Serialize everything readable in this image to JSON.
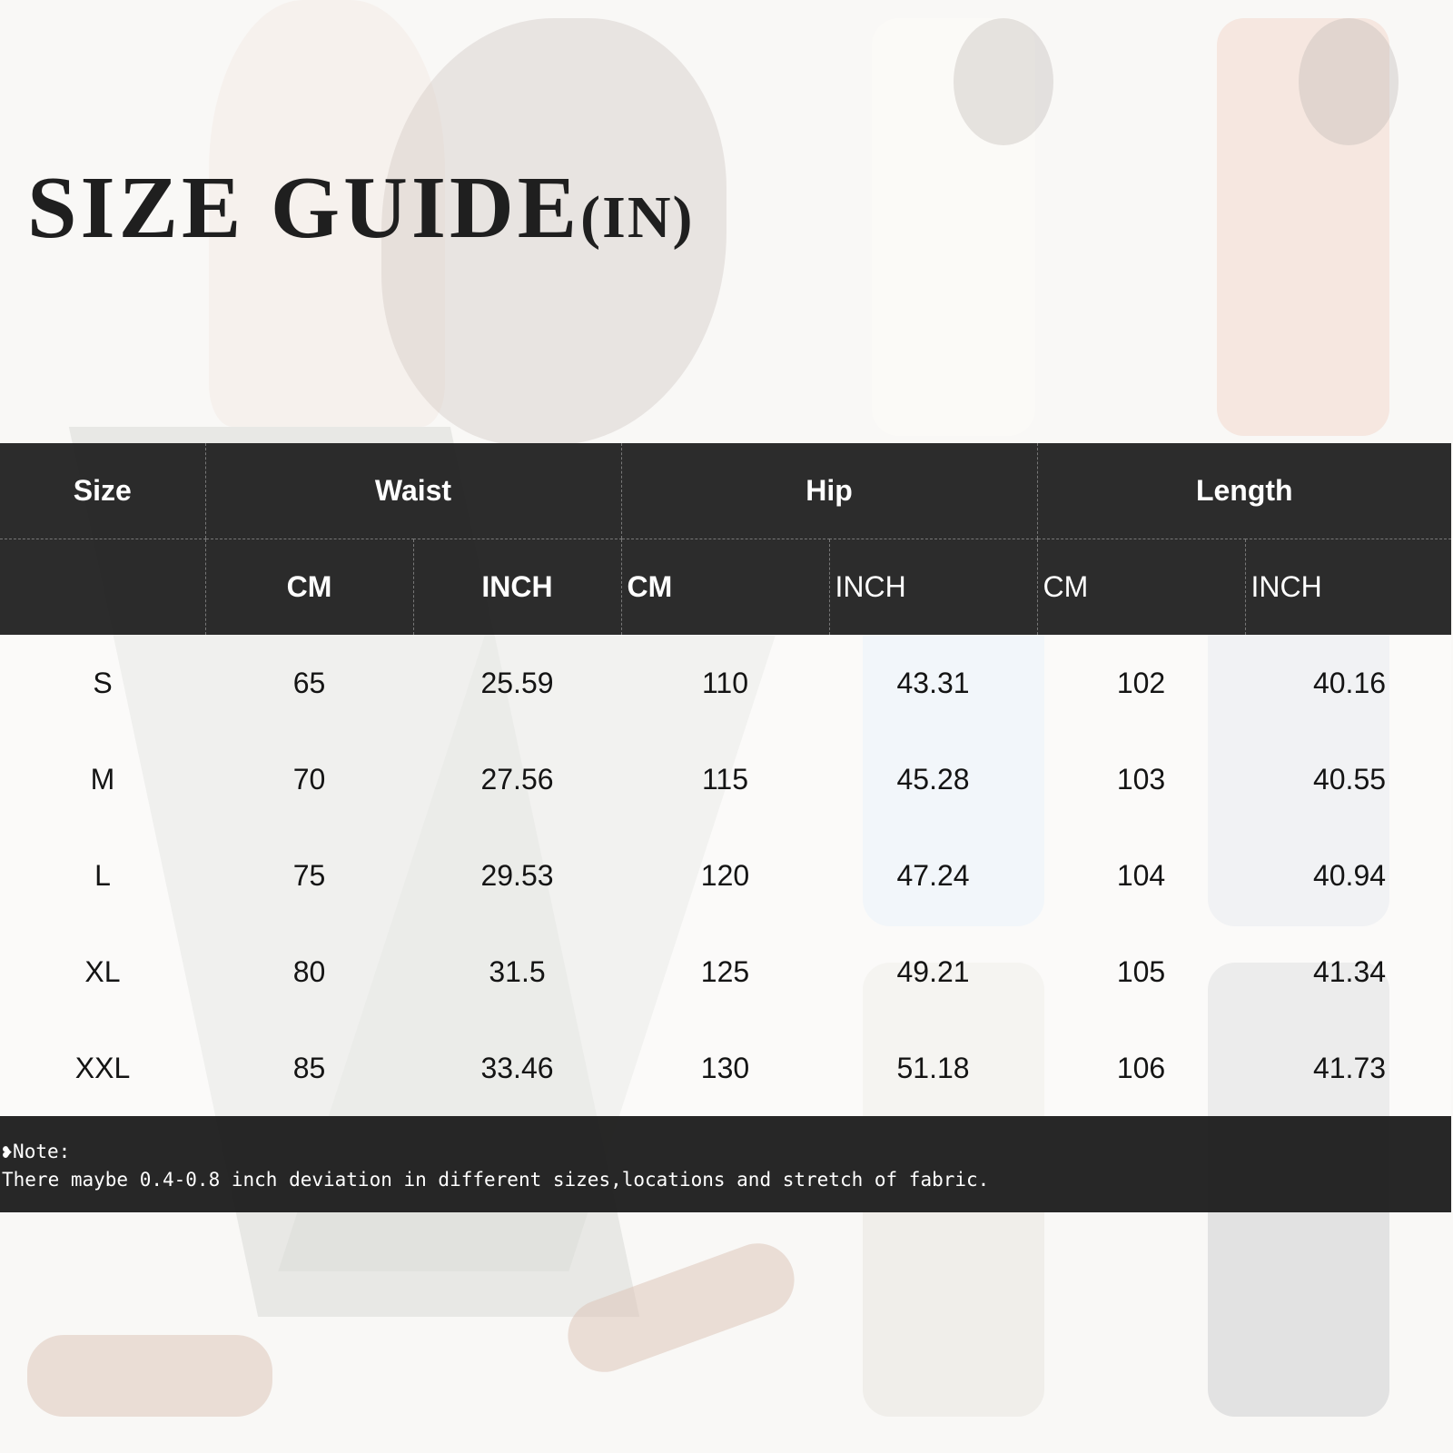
{
  "title": {
    "main": "SIZE GUIDE",
    "suffix": "(IN)"
  },
  "table": {
    "group_headers": [
      "Size",
      "Waist",
      "Hip",
      "Length"
    ],
    "unit_headers": [
      "",
      "CM",
      "INCH",
      "CM",
      "INCH",
      "CM",
      "INCH"
    ],
    "rows": [
      [
        "S",
        "65",
        "25.59",
        "110",
        "43.31",
        "102",
        "40.16"
      ],
      [
        "M",
        "70",
        "27.56",
        "115",
        "45.28",
        "103",
        "40.55"
      ],
      [
        "L",
        "75",
        "29.53",
        "120",
        "47.24",
        "104",
        "40.94"
      ],
      [
        "XL",
        "80",
        "31.5",
        "125",
        "49.21",
        "105",
        "41.34"
      ],
      [
        "XXL",
        "85",
        "33.46",
        "130",
        "51.18",
        "106",
        "41.73"
      ]
    ]
  },
  "note": {
    "bullet": "❥",
    "label": "Note:",
    "text": "There maybe 0.4-0.8 inch deviation in different sizes,locations and stretch of fabric."
  },
  "colors": {
    "header_bg": "#232323",
    "note_bg": "#1e1e1e",
    "text": "#141414"
  }
}
